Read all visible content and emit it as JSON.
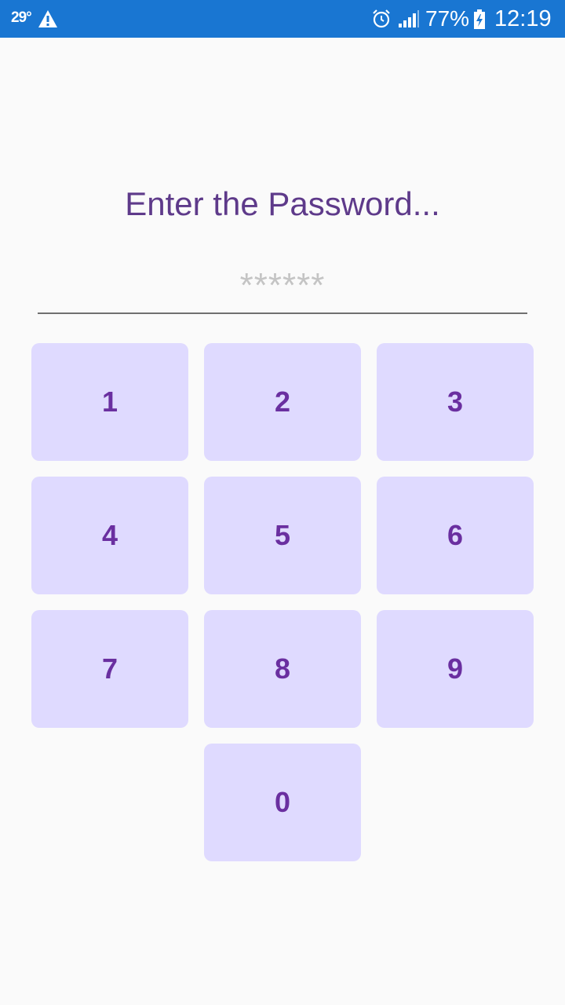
{
  "status_bar": {
    "temperature": "29°",
    "battery_percent": "77%",
    "time": "12:19",
    "icons": [
      "warning-icon",
      "alarm-icon",
      "signal-icon",
      "battery-charging-icon"
    ],
    "background_color": "#1976d2"
  },
  "screen": {
    "title": "Enter the Password...",
    "password_placeholder": "******",
    "password_value": ""
  },
  "keypad": {
    "keys": [
      "1",
      "2",
      "3",
      "4",
      "5",
      "6",
      "7",
      "8",
      "9",
      "0"
    ],
    "key_color": "#dfdaff",
    "key_text_color": "#6a2fa0"
  },
  "colors": {
    "title": "#5e3a8a",
    "background": "#fafafa"
  }
}
